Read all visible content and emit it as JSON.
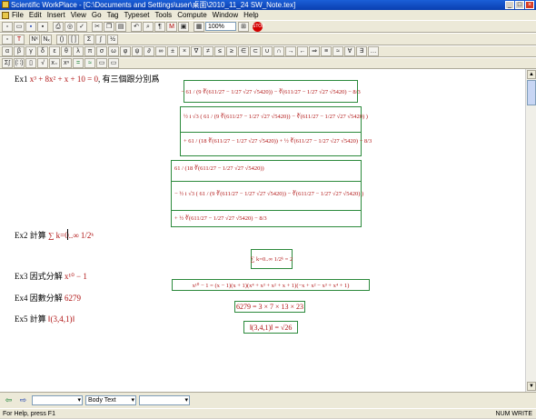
{
  "window": {
    "title": "Scientific WorkPlace - [C:\\Documents and Settings\\user\\桌面\\2010_11_24 SW_Note.tex]"
  },
  "menu": [
    "File",
    "Edit",
    "Insert",
    "View",
    "Go",
    "Tag",
    "Typeset",
    "Tools",
    "Compute",
    "Window",
    "Help"
  ],
  "toolbar": {
    "zoom": "100%",
    "stop_label": "STOP"
  },
  "bottom": {
    "tag_select": "",
    "style_select": "Body Text",
    "extra_select": ""
  },
  "status": {
    "left": "For Help, press F1",
    "right": "NUM   WRITE"
  },
  "doc": {
    "ex1": {
      "label": "Ex1",
      "equation": "x³ + 8x² + x + 10 = 0",
      "text": ", 有三個跟分別爲"
    },
    "sol1": "− 61 / (9 ∛(611/27 − 1/27 √27 √5420)) − ∛(611/27 − 1/27 √27 √5420) − 8/3",
    "sol2a": "½ i √3 ( 61 / (9 ∛(611/27 − 1/27 √27 √5420)) − ∛(611/27 − 1/27 √27 √5420) )",
    "sol2b": "+ 61 / (18 ∛(611/27 − 1/27 √27 √5420)) + ½ ∛(611/27 − 1/27 √27 √5420) − 8/3",
    "sol3a": "61 / (18 ∛(611/27 − 1/27 √27 √5420))",
    "sol3b": "− ½ i √3 ( 61 / (9 ∛(611/27 − 1/27 √27 √5420)) − ∛(611/27 − 1/27 √27 √5420) )",
    "sol3c": "+ ½ ∛(611/27 − 1/27 √27 √5420) − 8/3",
    "ex2": {
      "label": "Ex2 計算",
      "expr": "∑ k=0..∞ 1/2ᵏ"
    },
    "ex2_result": "∑ k=0..∞ 1/2ᵏ = 2",
    "ex3": {
      "label": "Ex3 因式分解",
      "expr": "x¹⁰ − 1"
    },
    "ex3_result": "x¹⁰ − 1 = (x − 1)(x + 1)(x⁴ + x³ + x² + x + 1)(−x + x² − x³ + x⁴ + 1)",
    "ex4": {
      "label": "Ex4 因數分解",
      "expr": "6279"
    },
    "ex4_result": "6279 = 3 × 7 × 13 × 23",
    "ex5": {
      "label": "Ex5 計算",
      "expr": "‖(3,4,1)‖"
    },
    "ex5_result": "‖(3,4,1)‖ = √26"
  }
}
